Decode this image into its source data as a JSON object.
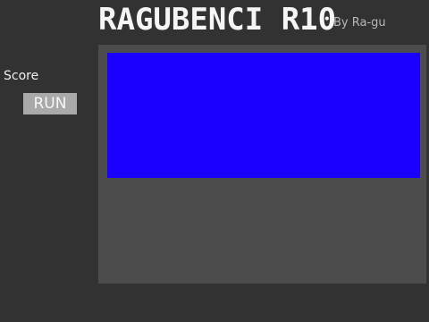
{
  "header": {
    "title": "RAGUBENCI R10",
    "byline": "By Ra-gu"
  },
  "sidebar": {
    "score_label": "Score",
    "run_label": "RUN"
  },
  "stage": {
    "playfield_color": "#1a00ff"
  },
  "colors": {
    "background": "#323232",
    "stage": "#4c4c4c",
    "run_button": "#a9a9a9"
  }
}
